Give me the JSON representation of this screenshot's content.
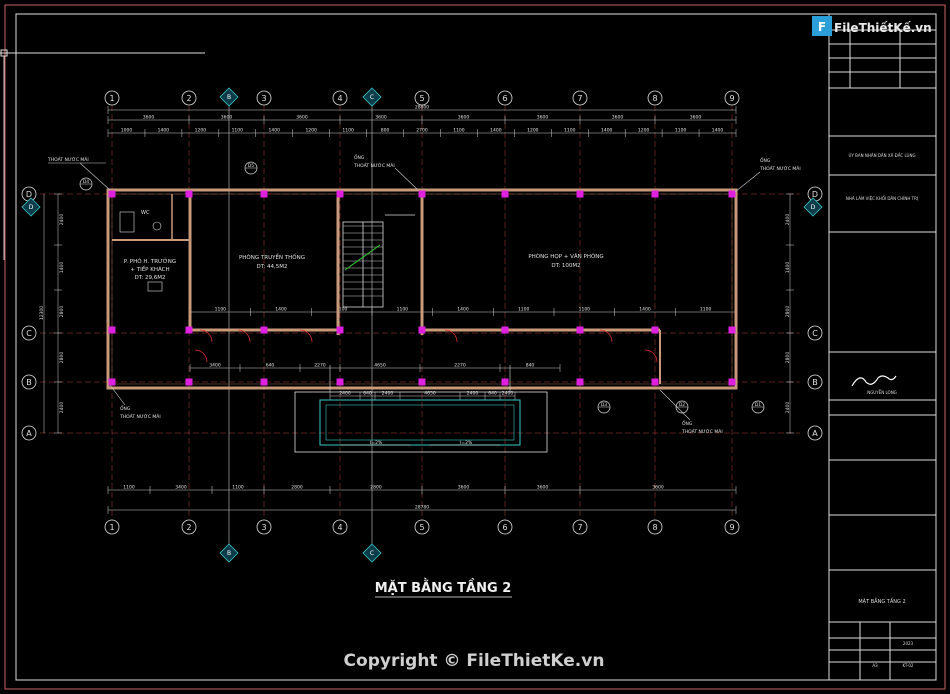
{
  "watermark": {
    "logo_text": "FileThiếtKế.vn",
    "copyright": "Copyright © FileThietKe.vn"
  },
  "drawing": {
    "title": "MẶT BẰNG TẦNG 2",
    "grid_columns": [
      "1",
      "2",
      "3",
      "4",
      "5",
      "6",
      "7",
      "8",
      "9"
    ],
    "grid_rows": [
      "D",
      "C",
      "B",
      "A"
    ],
    "section_marks": [
      "B",
      "C"
    ],
    "rooms": {
      "left_room": [
        "P. PHÓ H. TRƯỞNG",
        "+ TIẾP KHÁCH",
        "DT: 29,6M2"
      ],
      "wc": "WC",
      "room_a": [
        "PHÒNG TRUYỀN THỐNG",
        "DT: 44,5M2"
      ],
      "room_b": [
        "PHÒNG HỌP + VĂN PHÒNG",
        "DT: 100M2"
      ]
    },
    "callouts": {
      "pipe_tl": "THOÁT NƯỚC MÁI",
      "pipe_t": [
        "ỐNG",
        "THOÁT NƯỚC MÁI"
      ],
      "pipe_tr": [
        "ỐNG",
        "THOÁT NƯỚC MÁI"
      ],
      "pipe_bl": [
        "ỐNG",
        "THOÁT NƯỚC MÁI"
      ],
      "pipe_br": [
        "ỐNG",
        "THOÁT NƯỚC MÁI"
      ]
    },
    "detail_tags": [
      "D4",
      "D5",
      "D3",
      "D2",
      "D1"
    ],
    "slope_a": "I=2%",
    "slope_b": "I=2%",
    "top_dims_row1": [
      "3600",
      "3600",
      "3600",
      "3600",
      "3600",
      "3600",
      "3600",
      "3600"
    ],
    "top_dims_row2": [
      "1000",
      "1400",
      "1200",
      "1100",
      "1400",
      "1200",
      "1100",
      "800",
      "2700",
      "1100",
      "1400",
      "1200",
      "1100",
      "1400",
      "1200",
      "1100",
      "1400"
    ],
    "top_total": "28800",
    "bottom_dims_row1": [
      "1100",
      "3400",
      "1100",
      "2800",
      "2800",
      "3600",
      "3600",
      "3600"
    ],
    "bottom_total": "28780",
    "left_dims": [
      "2400",
      "1400",
      "2800",
      "2800",
      "2400"
    ],
    "side_total": "12300",
    "mid_dims": [
      "1100",
      "1400",
      "1100",
      "1100",
      "1400",
      "1100",
      "1100",
      "1400",
      "1100"
    ],
    "lower_dims": [
      "3400",
      "640",
      "2270",
      "4650",
      "2270",
      "840"
    ],
    "sunken_dims": [
      "2400",
      "640",
      "2400",
      "4650",
      "2400",
      "640",
      "2400"
    ]
  },
  "title_block": {
    "owner": "ỦY BAN NHÂN DÂN XÃ ĐẮC LÙNG",
    "project": "NHÀ LÀM VIỆC KHỐI DÂN CHÍNH TRỊ",
    "signer": "NGUYỄN LONG",
    "sheet_title": "MẶT BẰNG TẦNG 2",
    "scale": "A3",
    "sheet_no": "KT-02",
    "date": "2023"
  }
}
